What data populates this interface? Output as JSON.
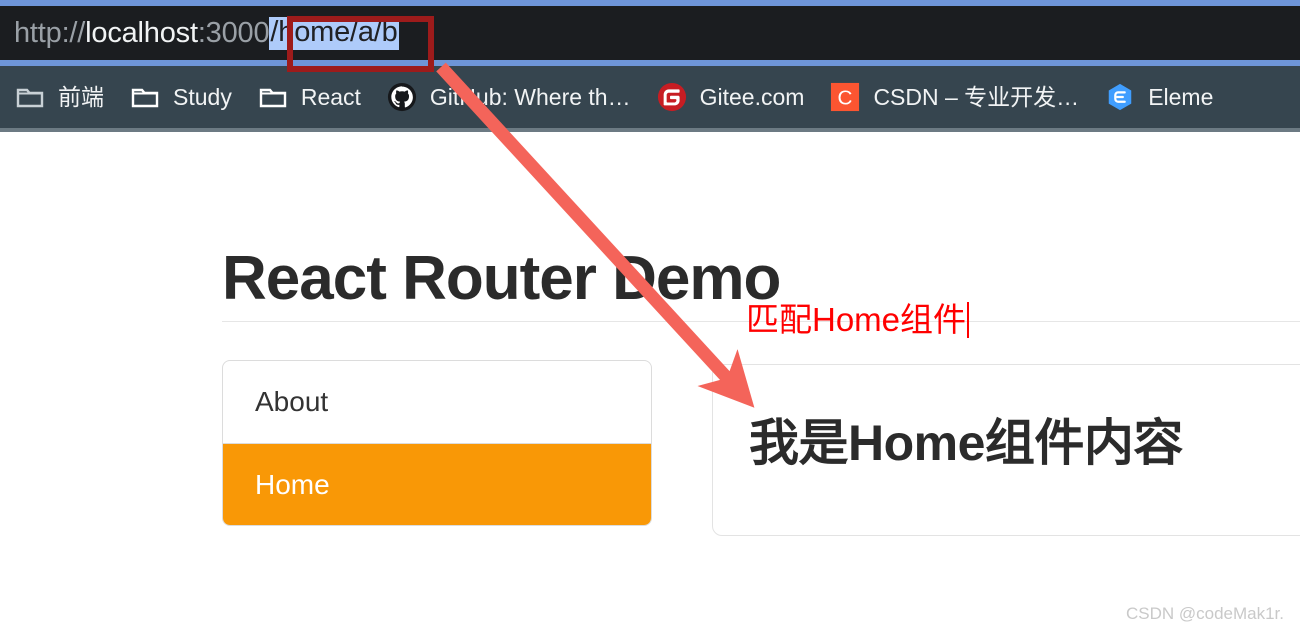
{
  "browser": {
    "url": {
      "scheme": "http://",
      "host": "localhost",
      "port": ":3000",
      "path_selected": "/home/a/b",
      "full": "http://localhost:3000/home/a/b"
    },
    "bookmarks": [
      {
        "label": "前端",
        "icon": "folder-icon"
      },
      {
        "label": "Study",
        "icon": "folder-icon"
      },
      {
        "label": "React",
        "icon": "folder-icon"
      },
      {
        "label": "GitHub: Where th…",
        "icon": "github-icon"
      },
      {
        "label": "Gitee.com",
        "icon": "gitee-icon"
      },
      {
        "label": "CSDN – 专业开发…",
        "icon": "csdn-icon"
      },
      {
        "label": "Eleme",
        "icon": "element-ui-icon"
      }
    ]
  },
  "page": {
    "title": "React Router Demo",
    "nav": [
      {
        "label": "About",
        "active": false
      },
      {
        "label": "Home",
        "active": true
      }
    ],
    "content": {
      "heading": "我是Home组件内容"
    }
  },
  "annotations": {
    "red_text": "匹配Home组件",
    "url_box_color": "#9d1b1b",
    "arrow_color": "#f4645a",
    "text_color": "#ff0000"
  },
  "watermark": "CSDN @codeMak1r.",
  "colors": {
    "accent_orange": "#f99806",
    "bookmarks_bg": "#36454f",
    "urlbar_bg": "#1b1d20",
    "chrome_band": "#6e95d8",
    "selection_blue": "#aecbfa"
  }
}
